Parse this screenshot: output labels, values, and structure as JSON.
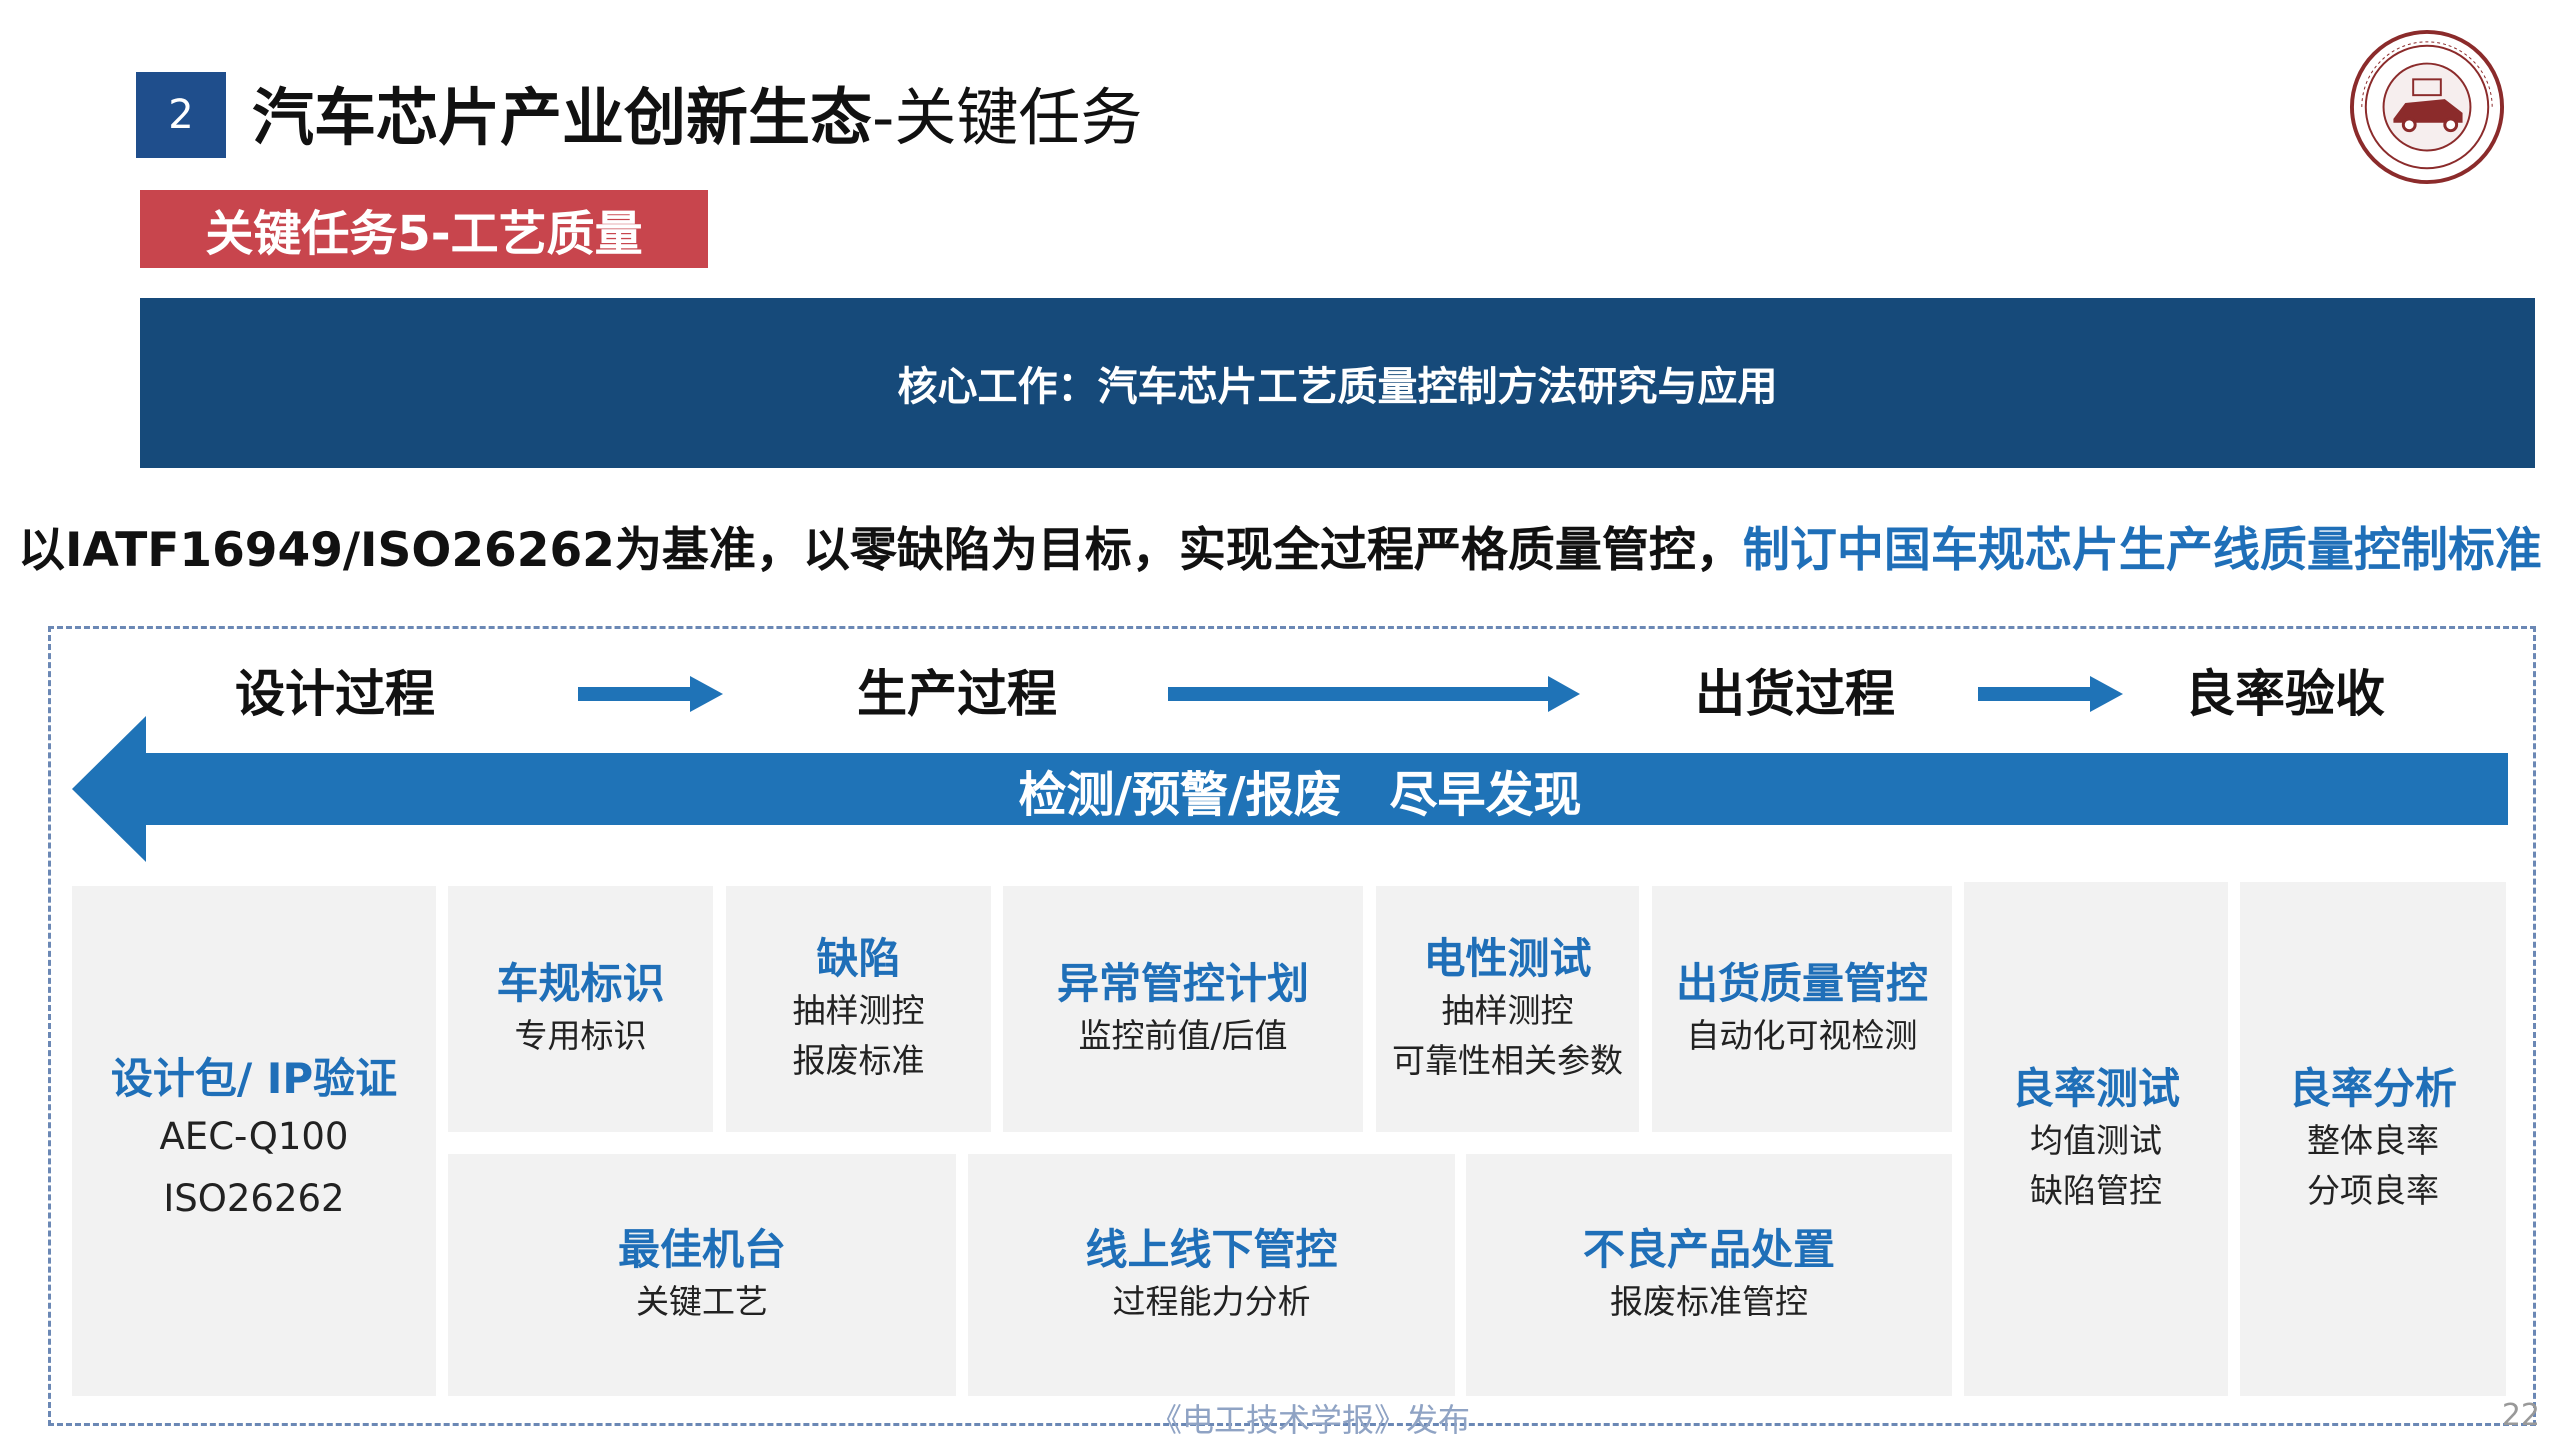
{
  "header": {
    "section_number": "2",
    "title_main": "汽车芯片产业创新生态",
    "title_suffix": "-关键任务",
    "task_tag": "关键任务5-工艺质量"
  },
  "core_banner": "核心工作：汽车芯片工艺质量控制方法研究与应用",
  "statement": {
    "plain": "以IATF16949/ISO26262为基准，以零缺陷为目标，实现全过程严格质量管控，",
    "highlight": "制订中国车规芯片生产线质量控制标准"
  },
  "process": {
    "steps": [
      "设计过程",
      "生产过程",
      "出货过程",
      "良率验收"
    ],
    "feedback_label": "检测/预警/报废　尽早发现"
  },
  "cards": {
    "design": {
      "title": "设计包/ IP验证",
      "lines": [
        "AEC-Q100",
        "ISO26262"
      ]
    },
    "label": {
      "title": "车规标识",
      "lines": [
        "专用标识"
      ]
    },
    "defect": {
      "title": "缺陷",
      "lines": [
        "抽样测控",
        "报废标准"
      ]
    },
    "abnormal": {
      "title": "异常管控计划",
      "lines": [
        "监控前值/后值"
      ]
    },
    "electrical": {
      "title": "电性测试",
      "lines": [
        "抽样测控",
        "可靠性相关参数"
      ]
    },
    "shipqc": {
      "title": "出货质量管控",
      "lines": [
        "自动化可视检测"
      ]
    },
    "machine": {
      "title": "最佳机台",
      "lines": [
        "关键工艺"
      ]
    },
    "online": {
      "title": "线上线下管控",
      "lines": [
        "过程能力分析"
      ]
    },
    "defective": {
      "title": "不良产品处置",
      "lines": [
        "报废标准管控"
      ]
    },
    "yieldtest": {
      "title": "良率测试",
      "lines": [
        "均值测试",
        "缺陷管控"
      ]
    },
    "yieldanalysis": {
      "title": "良率分析",
      "lines": [
        "整体良率",
        "分项良率"
      ]
    }
  },
  "footer": {
    "source": "《电工技术学报》发布",
    "page": "22"
  },
  "colors": {
    "navy_banner": "#164a7a",
    "section_blue": "#1f4e8c",
    "task_red": "#c8454d",
    "arrow_blue": "#1f73b7",
    "highlight_blue": "#1f6fb8",
    "card_bg": "#f2f2f2",
    "seal_red": "#8b2b2b"
  },
  "icons": {
    "logo": "seal-logo",
    "flow_arrows": "right-arrow",
    "feedback_arrow": "left-arrow"
  }
}
